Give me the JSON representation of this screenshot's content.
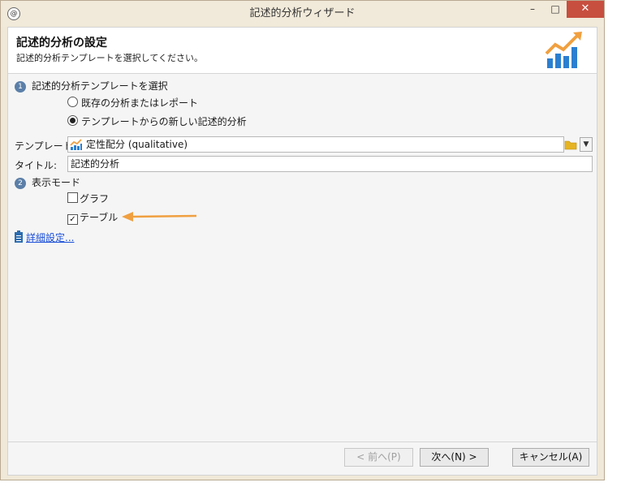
{
  "window": {
    "title": "記述的分析ウィザード",
    "minimize": "–",
    "maximize": "□",
    "close": "✕"
  },
  "header": {
    "title": "記述的分析の設定",
    "subtitle": "記述的分析テンプレートを選択してください。"
  },
  "step1": {
    "number": "1",
    "label": "記述的分析テンプレートを選択",
    "options": [
      "既存の分析またはレポート",
      "テンプレートからの新しい記述的分析"
    ],
    "selected_index": 1
  },
  "template": {
    "label": "テンプレート:",
    "value": "定性配分 (qualitative)"
  },
  "title_field": {
    "label": "タイトル:",
    "value": "記述的分析"
  },
  "step2": {
    "number": "2",
    "label": "表示モード",
    "graph_label": "グラフ",
    "graph_checked": false,
    "table_label": "テーブル",
    "table_checked": true
  },
  "advanced_link": "詳細設定...",
  "buttons": {
    "prev": "< 前へ(P)",
    "next": "次へ(N) >",
    "cancel": "キャンセル(A)"
  },
  "colors": {
    "accent_orange": "#f0a040",
    "chart_blue": "#2b7fd0",
    "step_badge": "#5b7fa8",
    "close_button": "#c74f3f"
  }
}
